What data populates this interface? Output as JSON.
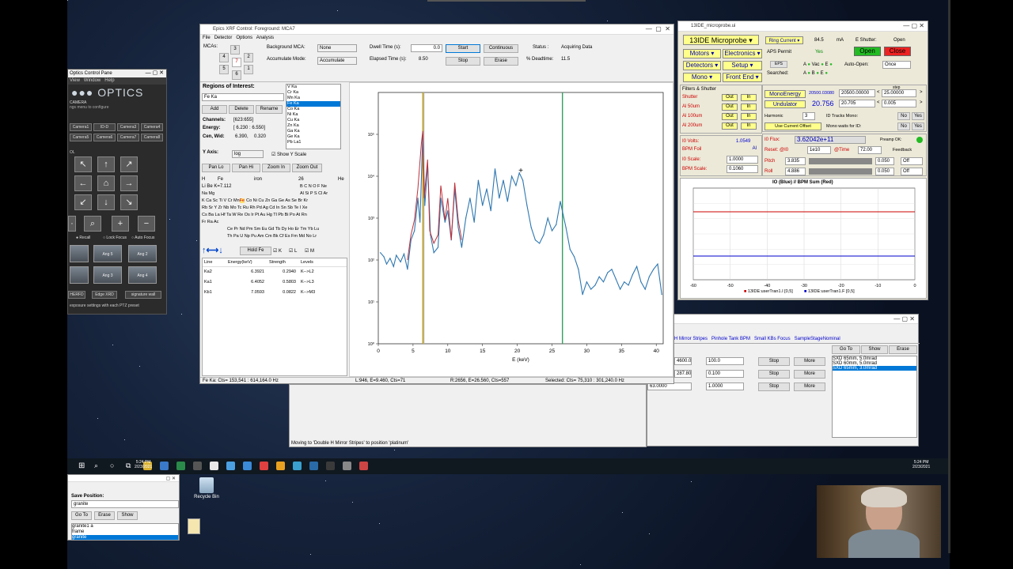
{
  "xrf": {
    "title": "Epics XRF Control: Foreground: MCA7",
    "menu": [
      "File",
      "Detector",
      "Options",
      "Analysis"
    ],
    "mcas_label": "MCAs:",
    "mca_numbers": [
      "3",
      "4",
      "7",
      "2",
      "5",
      "1",
      "6"
    ],
    "bg_mca_label": "Background MCA:",
    "bg_mca_value": "None",
    "acc_mode_label": "Accumulate Mode:",
    "acc_mode_value": "Accumulate",
    "dwell_label": "Dwell Time (s):",
    "dwell_value": "0.0",
    "elapsed_label": "Elapsed Time (s):",
    "elapsed_value": "8.50",
    "start": "Start",
    "stop": "Stop",
    "continuous": "Continuous",
    "erase": "Erase",
    "status_label": "Status :",
    "status_value": "Acquiring Data",
    "deadtime_label": "% Deadtime:",
    "deadtime_value": "11.5",
    "roi_label": "Regions of Interest:",
    "roi_value": "Fe Ka",
    "roi_list": [
      "V Ka",
      "Cr Ka",
      "Mn Ka",
      "Fe Ka",
      "Co Ka",
      "Ni Ka",
      "Cu Ka",
      "Zn Ka",
      "Ga Ka",
      "Ge Ka",
      "Pb La1"
    ],
    "add": "Add",
    "delete": "Delete",
    "rename": "Rename",
    "channels_label": "Channels:",
    "channels_value": "[623:655]",
    "energy_label": "Energy:",
    "energy_value": "[ 6.230 : 6.550]",
    "cenwid_label": "Cen, Wid:",
    "cen_value": "6.390,",
    "wid_value": "0.320",
    "yaxis_label": "Y Axis:",
    "yaxis_value": "log",
    "show_yscale": "Show Y Scale",
    "panlo": "Pan Lo",
    "panhi": "Pan Hi",
    "zoomin": "Zoom In",
    "zoomout": "Zoom Out",
    "pt_header": {
      "h": "H",
      "fe": "Fe",
      "iron": "iron",
      "z": "26",
      "he": "He",
      "line2": "Li  Be K=7.112"
    },
    "pt_rows": [
      "Li Be                                              B  C  N  O  F  Ne",
      "Na Mg                                             Al Si  P  S  Cl  Ar",
      "K  Ca Sc Ti  V  Cr Mn Fe Co Ni Cu Zn Ga Ge As Se Br  Kr",
      "Rb Sr  Y  Zr Nb Mo Tc Ru Rh Pd Ag Cd In Sn Sb Te  I   Xe",
      "Cs Ba La Hf Ta  W Re Os Ir Pt Au Hg Tl Pb Bi Po At Rn",
      "Fr Ra Ac",
      "Ce Pr Nd Pm Sm Eu Gd Tb Dy Ho Er Tm Yb Lu",
      "Th Pa  U  Np Pu Am Cm Bk Cf Es Fm Md No Lr"
    ],
    "holdfe": "Hold Fe",
    "chk_k": "K",
    "chk_l": "L",
    "chk_m": "M",
    "line_table_headers": [
      "Line",
      "Energy(keV)",
      "Strength",
      "Levels"
    ],
    "line_table": [
      [
        "Ka2",
        "6.3921",
        "0.2940",
        "K-->L2"
      ],
      [
        "Ka1",
        "6.4052",
        "0.5803",
        "K-->L3"
      ],
      [
        "Kb1",
        "7.0593",
        "0.0822",
        "K-->M3"
      ]
    ],
    "status_left": "Fe Ka: Cts=   153,541 : 614,164.0 Hz",
    "status_mid": "L:946, E=9.460, Cts=71",
    "status_r": "R:2656, E=26.560, Cts=557",
    "status_sel": "Selected: Cts=   75,310 : 301,240.0 Hz"
  },
  "chart_data": {
    "type": "line",
    "xlabel": "E (keV)",
    "yscale": "log",
    "xlim": [
      0,
      41
    ],
    "ylim": [
      1,
      1000000
    ],
    "xticks": [
      "0",
      "5",
      "10",
      "15",
      "20",
      "25",
      "30",
      "35",
      "40"
    ],
    "yticks": [
      "10⁰",
      "10¹",
      "10²",
      "10³",
      "10⁴",
      "10⁵"
    ],
    "series": [
      {
        "color": "#2e77b0",
        "x": [
          0.3,
          0.8,
          1.2,
          1.7,
          2.2,
          2.6,
          3.2,
          3.7,
          4.2,
          4.7,
          5.2,
          5.7,
          6.0,
          6.4,
          6.7,
          7.1,
          7.5,
          8.0,
          8.6,
          9.0,
          9.6,
          10.0,
          10.5,
          11.0,
          11.5,
          12.0,
          12.6,
          13.2,
          13.8,
          14.4,
          15.0,
          15.6,
          16.2,
          16.8,
          17.4,
          18.0,
          18.6,
          19.2,
          19.8,
          20.3,
          20.8,
          21.4,
          22.0,
          22.6,
          23.2,
          23.8,
          24.4,
          25.0,
          25.6,
          26.2,
          26.6,
          27.0,
          27.6,
          28.2,
          28.8,
          29.4,
          30.0,
          30.6,
          31.2,
          31.8,
          32.4,
          33.0,
          33.6,
          34.2,
          34.8,
          35.4,
          36.0,
          36.6,
          37.2,
          37.8,
          38.4,
          39.0,
          39.6,
          40.2,
          40.8
        ],
        "y": [
          150,
          120,
          80,
          110,
          70,
          130,
          90,
          140,
          60,
          300,
          500,
          3000,
          800,
          100000,
          2000,
          20000,
          400,
          150,
          200,
          3000,
          800,
          1500,
          300,
          5000,
          600,
          200,
          1000,
          3000,
          800,
          8000,
          2000,
          5000,
          1500,
          15000,
          3000,
          8000,
          2500,
          10000,
          6000,
          12000,
          8000,
          2000,
          600,
          300,
          250,
          400,
          1000,
          500,
          700,
          2500,
          1200,
          600,
          180,
          120,
          60,
          15,
          30,
          20,
          25,
          40,
          30,
          50,
          60,
          35,
          20,
          30,
          25,
          45,
          70,
          30,
          20,
          40,
          60,
          80,
          15
        ]
      }
    ],
    "markers": [
      {
        "x": 6.4,
        "color": "#c8a400"
      },
      {
        "x": 6.55,
        "color": "#b0b0b0"
      },
      {
        "x": 26.5,
        "color": "#33a060"
      }
    ]
  },
  "cam": {
    "title": "Optics Control Pane",
    "menu": [
      "View",
      "Window",
      "Help"
    ],
    "logo": "OPTICS",
    "camera": "CAMERA",
    "hint": "ngs menu to configure",
    "buttons": [
      "Camera1",
      "ID-D",
      "Camera3",
      "Camera4",
      "Camera5",
      "Camera6",
      "Camera7",
      "Camera8"
    ],
    "ol": "OL",
    "recall": "Recall",
    "lockfocus": "Lock Focus",
    "autofocus": "Auto Focus",
    "thumbs": [
      "",
      "Ang 5",
      "Ang 2",
      "",
      "Ang 3",
      "Ang 4"
    ],
    "bottom": [
      "HERFD",
      "Edge XRD",
      "signature wall"
    ],
    "footer": "exposure settings with each PTZ preset"
  },
  "mp": {
    "title": "13IDE_microprobe.ui",
    "name": "13IDE Microprobe",
    "ring_label": "Ring Current",
    "ring_value": "84.5",
    "ring_unit": "mA",
    "eshutter_label": "E Shutter:",
    "eshutter_value": "Open",
    "open": "Open",
    "close": "Close",
    "aps_label": "APS Permit",
    "aps_value": "Yes",
    "eps": "EPS",
    "a": "A",
    "vac": "Vac",
    "e": "E",
    "autoopen_label": "Auto-Open:",
    "autoopen_value": "Once",
    "searched": "Searched:",
    "b": "B",
    "menus": [
      "Motors",
      "Electronics",
      "Detectors",
      "Setup",
      "Mono",
      "Front End"
    ],
    "filters_label": "Filters & Shutter",
    "filters": [
      [
        "Shutter",
        "Out",
        "In"
      ],
      [
        "Al  50um",
        "Out",
        "In"
      ],
      [
        "Al  100um",
        "Out",
        "In"
      ],
      [
        "Al  200um",
        "Out",
        "In"
      ]
    ],
    "monoenergy": "MonoEnergy",
    "mono_rbv": "20500.03080",
    "mono_val": "20500.00000",
    "step_label": "step",
    "step_val": "25.00000",
    "undulator": "Undulator",
    "und_rbv": "20.756",
    "und_val": "20.705",
    "und_step": "0.005",
    "harmonic_label": "Harmonic",
    "harmonic_val": "3",
    "idtracks": "ID Tracks Mono:",
    "no": "No",
    "yes": "Yes",
    "usecur": "Use Current Offset",
    "monowaits": "Mono waits for ID:",
    "i0volts_label": "I0 Volts:",
    "i0volts": "1.0549",
    "bpmfoil_label": "BPM Foil",
    "bpmfoil": "Al",
    "i0scale_label": "I0 Scale:",
    "i0scale": "1.0000",
    "bpmscale_label": "BPM Scale:",
    "bpmscale": "0.1060",
    "i0flux_label": "I0 Flux:",
    "i0flux": "3.62042e+11",
    "preamp": "Preamp OK:",
    "reset_label": "Reset: @I0",
    "reset_val": "1e10",
    "time_label": "@Time",
    "time_val": "72.00",
    "feedback": "Feedback",
    "pitch_label": "Pitch",
    "pitch_val": "3.835",
    "pitch_step": "0.050",
    "off": "Off",
    "roll_label": "Roll",
    "roll_val": "4.886",
    "roll_step": "0.050",
    "plot_title": "IO (Blue) // BPM Sum (Red)",
    "plot_xticks": [
      "-60",
      "-50",
      "-40",
      "-30",
      "-20",
      "-10",
      "0"
    ],
    "legend1": "13IDE:userTran1.I [0,5]",
    "legend2": "13IDE:userTran1.F [0,5]"
  },
  "pos": {
    "tabs": [
      "H Mirror Stripes",
      "Pinhole Tank BPM",
      "Small KBs Focus",
      "SampleStageNominal"
    ],
    "goto": "Go To",
    "show": "Show",
    "erase": "Erase",
    "list": [
      "SXD 65mm, 5.0mrad",
      "SXD 60mm, 5.0mrad",
      "SXD 65mm, 3.0mrad"
    ],
    "rows": [
      [
        "4600.0",
        "100.0",
        "Stop",
        "More"
      ],
      [
        "287.801",
        "0.100",
        "Stop",
        "More"
      ],
      [
        "63.0000",
        "1.0000",
        "Stop",
        "More"
      ]
    ],
    "hint": "Moving to 'Double H Mirror Stripes' to position 'platinum'"
  },
  "save": {
    "title": "Save Position:",
    "value": "granite",
    "goto": "Go To",
    "erase": "Erase",
    "show": "Show",
    "list": [
      "granite1 a",
      "frame",
      "granite"
    ]
  },
  "desktop": {
    "recycle": "Recycle Bin"
  },
  "taskbar": {
    "time": "5:24 PM",
    "date": "2/23/2021"
  },
  "colors": {
    "accent": "#0078d7",
    "yellow": "#ffff8c",
    "green": "#22bb22",
    "red": "#ee2222"
  }
}
